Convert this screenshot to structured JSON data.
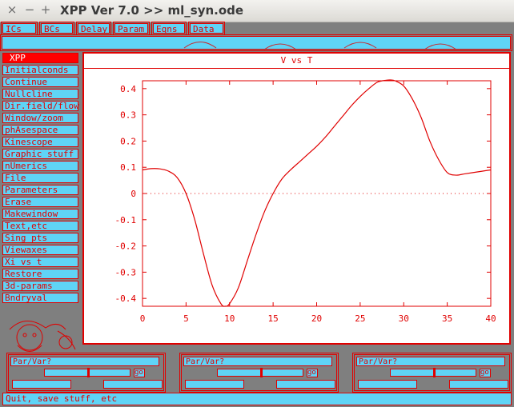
{
  "window": {
    "title": "XPP Ver 7.0 >> ml_syn.ode",
    "close_glyph": "×",
    "minimize_glyph": "−",
    "maximize_glyph": "+"
  },
  "toolbar": {
    "buttons": [
      "ICs",
      "BCs",
      "Delay",
      "Param",
      "Eqns",
      "Data"
    ]
  },
  "command_line": {
    "value": ""
  },
  "menu": {
    "header": "XPP",
    "items": [
      "Initialconds",
      "Continue",
      "Nullcline",
      "Dir.field/flow",
      "Window/zoom",
      "phAsespace",
      "Kinescope",
      "Graphic stuff",
      "nUmerics",
      "File",
      "Parameters",
      "Erase",
      "Makewindow",
      "Text,etc",
      "Sing pts",
      "Viewaxes",
      "Xi vs t",
      "Restore",
      "3d-params",
      "Bndryval"
    ]
  },
  "plot": {
    "window_title": "V vs T",
    "x_ticks": [
      "0",
      "5",
      "10",
      "15",
      "20",
      "25",
      "30",
      "35",
      "40"
    ],
    "y_ticks": [
      "0.4",
      "0.3",
      "0.2",
      "0.1",
      "0",
      "-0.1",
      "-0.2",
      "-0.3",
      "-0.4"
    ]
  },
  "chart_data": {
    "type": "line",
    "title": "V vs T",
    "xlabel": "",
    "ylabel": "",
    "xlim": [
      0,
      40
    ],
    "ylim": [
      -0.43,
      0.43
    ],
    "zero_line": true,
    "series": [
      {
        "color": "#e00000",
        "x": [
          0,
          1,
          2,
          3,
          4,
          5,
          6,
          7,
          8,
          9,
          9.5,
          10,
          11,
          12,
          13,
          14,
          15,
          16,
          17,
          18,
          19,
          20,
          21,
          22,
          23,
          24,
          25,
          26,
          27,
          28,
          28.5,
          29,
          30,
          31,
          32,
          33,
          34,
          35,
          36,
          37,
          38,
          39,
          40
        ],
        "y": [
          0.09,
          0.095,
          0.094,
          0.085,
          0.06,
          0.0,
          -0.1,
          -0.23,
          -0.35,
          -0.42,
          -0.43,
          -0.42,
          -0.36,
          -0.26,
          -0.16,
          -0.07,
          0.0,
          0.055,
          0.09,
          0.12,
          0.15,
          0.18,
          0.215,
          0.255,
          0.295,
          0.335,
          0.37,
          0.4,
          0.425,
          0.432,
          0.433,
          0.43,
          0.41,
          0.36,
          0.29,
          0.2,
          0.13,
          0.08,
          0.07,
          0.075,
          0.08,
          0.085,
          0.09
        ]
      }
    ]
  },
  "param_panels": [
    {
      "label": "Par/Var?",
      "go_label": "go",
      "value": 0.5
    },
    {
      "label": "Par/Var?",
      "go_label": "go",
      "value": 0.5
    },
    {
      "label": "Par/Var?",
      "go_label": "go",
      "value": 0.5
    }
  ],
  "status": {
    "text": "Quit, save stuff, etc"
  },
  "colors": {
    "accent": "#e00000",
    "button_bg": "#5fd4f6",
    "background": "#7f7f7f"
  }
}
